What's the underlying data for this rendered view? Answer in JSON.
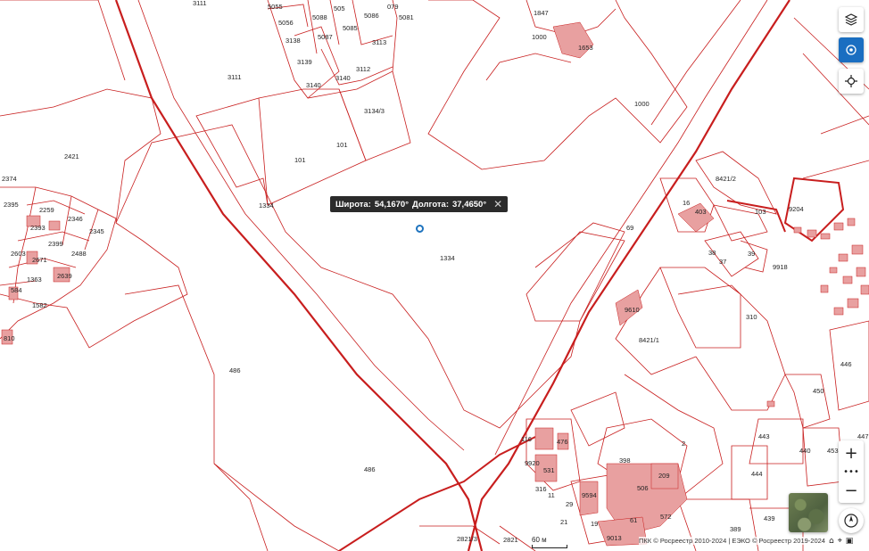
{
  "tooltip": {
    "lat_label": "Широта:",
    "lat_value": "54,1670°",
    "lon_label": "Долгота:",
    "lon_value": "37,4650°",
    "close_icon": "close-icon"
  },
  "controls": {
    "layers_icon": "layers-icon",
    "location_icon": "target-icon",
    "crosshair_icon": "crosshair-icon",
    "zoom_in": "+",
    "zoom_more": "•••",
    "zoom_out": "−",
    "compass_icon": "compass-icon",
    "basemap_icon": "satellite-thumbnail-icon"
  },
  "scale": {
    "label": "60 м"
  },
  "attribution": {
    "text": "ПКК © Росреестр 2010-2024 | ЕЭКО © Росреестр 2019-2024"
  },
  "colors": {
    "parcel_line": "#c81e1e",
    "building_fill": "#e8a0a0",
    "accent": "#1a6ec1"
  },
  "parcels": [
    "3111",
    "5055",
    "5056",
    "5088",
    "505",
    "5086",
    "079",
    "5081",
    "1847",
    "3138",
    "5087",
    "5085",
    "3113",
    "1000",
    "1653",
    "3139",
    "3112",
    "3140",
    "3140",
    "3111",
    "3134/3",
    "1000",
    "101",
    "101",
    "2421",
    "2374",
    "1334",
    "8421/2",
    "16",
    "403",
    "103",
    "9204",
    "2259",
    "2346",
    "2395",
    "2393",
    "2399",
    "2345",
    "69",
    "2603",
    "2671",
    "2488",
    "2639",
    "1334",
    "38",
    "37",
    "39",
    "9918",
    "1363",
    "584",
    "1582",
    "810",
    "9610",
    "310",
    "8421/1",
    "486",
    "446",
    "450",
    "116",
    "476",
    "9920",
    "531",
    "398",
    "2",
    "443",
    "440",
    "453",
    "447",
    "486",
    "316",
    "11",
    "9594",
    "29",
    "209",
    "506",
    "61",
    "572",
    "444",
    "21",
    "19",
    "439",
    "389",
    "2821/3",
    "2821",
    "9013"
  ]
}
